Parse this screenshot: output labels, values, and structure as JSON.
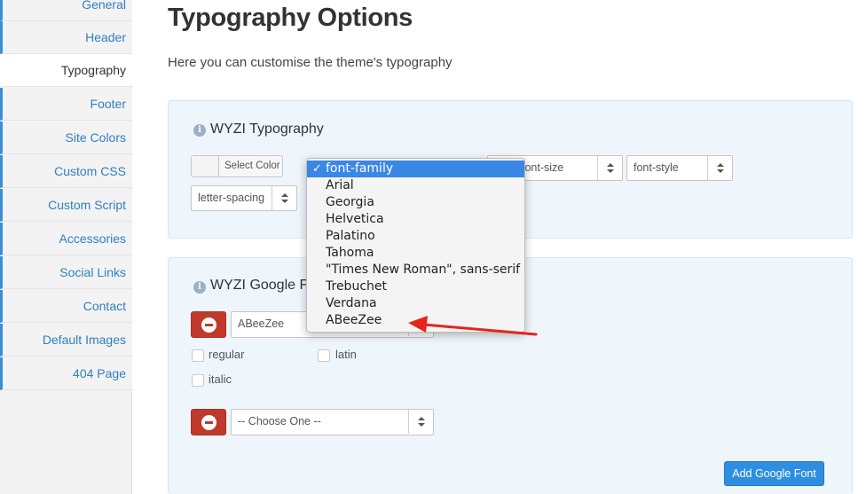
{
  "sidebar": {
    "items": [
      {
        "label": "General"
      },
      {
        "label": "Header"
      },
      {
        "label": "Typography"
      },
      {
        "label": "Footer"
      },
      {
        "label": "Site Colors"
      },
      {
        "label": "Custom CSS"
      },
      {
        "label": "Custom Script"
      },
      {
        "label": "Accessories"
      },
      {
        "label": "Social Links"
      },
      {
        "label": "Contact"
      },
      {
        "label": "Default Images"
      },
      {
        "label": "404 Page"
      }
    ],
    "active": "Typography"
  },
  "main": {
    "title": "Typography Options",
    "description": "Here you can customise the theme's typography"
  },
  "typography_panel": {
    "info_icon": "i",
    "title": "WYZI Typography",
    "select_color_label": "Select Color",
    "font_size_value": "font-size",
    "font_style_value": "font-style",
    "letter_spacing_value": "letter-spacing"
  },
  "google_panel": {
    "info_icon": "i",
    "title": "WYZI Google Fo",
    "font1_value": "ABeeZee",
    "checkbox_regular": "regular",
    "checkbox_latin": "latin",
    "checkbox_italic": "italic",
    "font2_value": "-- Choose One --",
    "add_button": "Add Google Font"
  },
  "dropdown": {
    "check_mark": "✓",
    "options": [
      {
        "label": "font-family",
        "selected": true
      },
      {
        "label": "Arial"
      },
      {
        "label": "Georgia"
      },
      {
        "label": "Helvetica"
      },
      {
        "label": "Palatino"
      },
      {
        "label": "Tahoma"
      },
      {
        "label": "\"Times New Roman\", sans-serif"
      },
      {
        "label": "Trebuchet"
      },
      {
        "label": "Verdana"
      },
      {
        "label": "ABeeZee"
      }
    ]
  },
  "colors": {
    "link": "#2f7fc1",
    "accent": "#3b87e6",
    "danger": "#c0392b",
    "annotation_arrow": "#e8231b"
  }
}
